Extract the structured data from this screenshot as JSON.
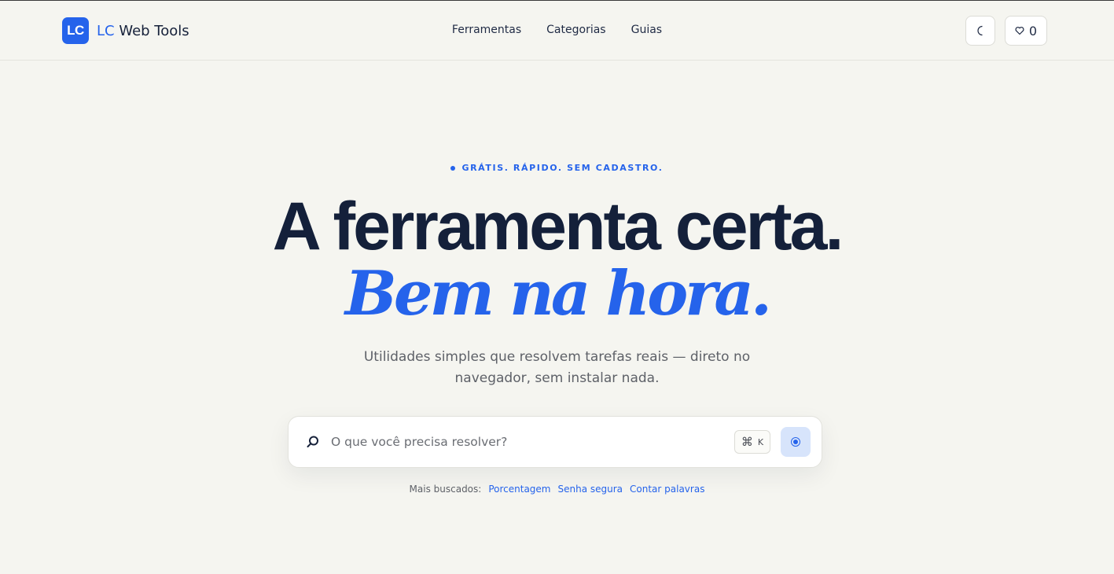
{
  "header": {
    "logo_text": "LC",
    "brand_accent": "LC",
    "brand_name": "Web Tools",
    "nav": [
      "Ferramentas",
      "Categorias",
      "Guias"
    ],
    "theme_icon": "moon-icon",
    "favorites_icon": "heart-icon",
    "favorites_count": "0"
  },
  "hero": {
    "eyebrow": "GRÁTIS. RÁPIDO. SEM CADASTRO.",
    "headline": "A ferramenta certa.",
    "headline_accent": "Bem na hora.",
    "subtitle_line1": "Utilidades simples que resolvem tarefas reais — direto no",
    "subtitle_line2": "navegador, sem instalar nada."
  },
  "search": {
    "placeholder": "O que você precisa resolver?",
    "value": "",
    "shortcut_symbol": "⌘",
    "shortcut_key": "K",
    "search_icon": "search-icon",
    "action_icon": "voice-icon"
  },
  "popular": {
    "label": "Mais buscados:",
    "items": [
      "Porcentagem",
      "Senha segura",
      "Contar palavras"
    ]
  },
  "colors": {
    "accent": "#2563eb",
    "background": "#f5f5f0",
    "text": "#16213a"
  }
}
